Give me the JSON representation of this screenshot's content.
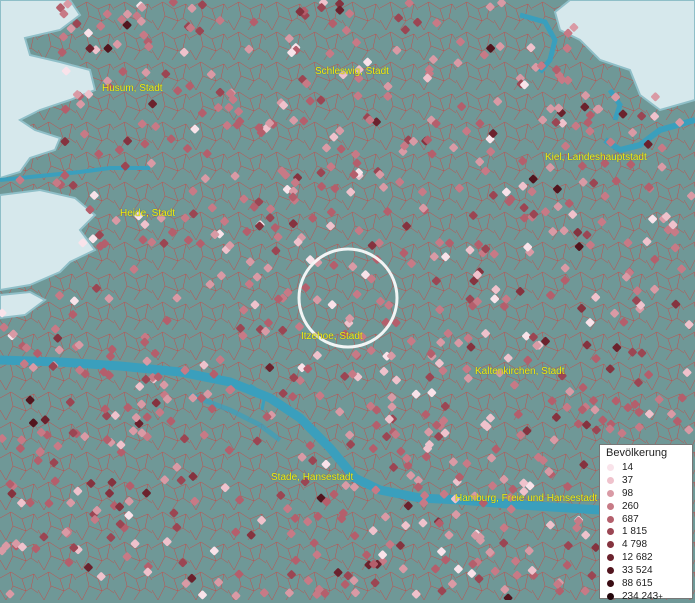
{
  "map": {
    "cities": [
      {
        "label": "Husum, Stadt"
      },
      {
        "label": "Schleswig, Stadt"
      },
      {
        "label": "Kiel, Landeshauptstadt"
      },
      {
        "label": "Heide, Stadt"
      },
      {
        "label": "Itzehoe, Stadt"
      },
      {
        "label": "Kaltenkirchen, Stadt"
      },
      {
        "label": "Stade, Hansestadt"
      },
      {
        "label": "Hamburg, Freie und Hansestadt"
      }
    ],
    "colors": {
      "water": "#d6e8ec",
      "land": "#6f9897",
      "river": "#3a9fbd",
      "boundary": "#e0312f",
      "label": "#f2ee10"
    }
  },
  "legend": {
    "title": "Bevölkerung",
    "items": [
      {
        "label": "14",
        "color": "#f9e3ea"
      },
      {
        "label": "37",
        "color": "#efc2cc"
      },
      {
        "label": "98",
        "color": "#d99aa5"
      },
      {
        "label": "260",
        "color": "#c77a86"
      },
      {
        "label": "687",
        "color": "#b45f6c"
      },
      {
        "label": "1 815",
        "color": "#9b4653"
      },
      {
        "label": "4 798",
        "color": "#85333f"
      },
      {
        "label": "12 682",
        "color": "#6b222d"
      },
      {
        "label": "33 524",
        "color": "#52151e"
      },
      {
        "label": "88 615",
        "color": "#3a0c13"
      },
      {
        "label": "234 243",
        "color": "#22050a",
        "suffix": "+"
      }
    ]
  }
}
